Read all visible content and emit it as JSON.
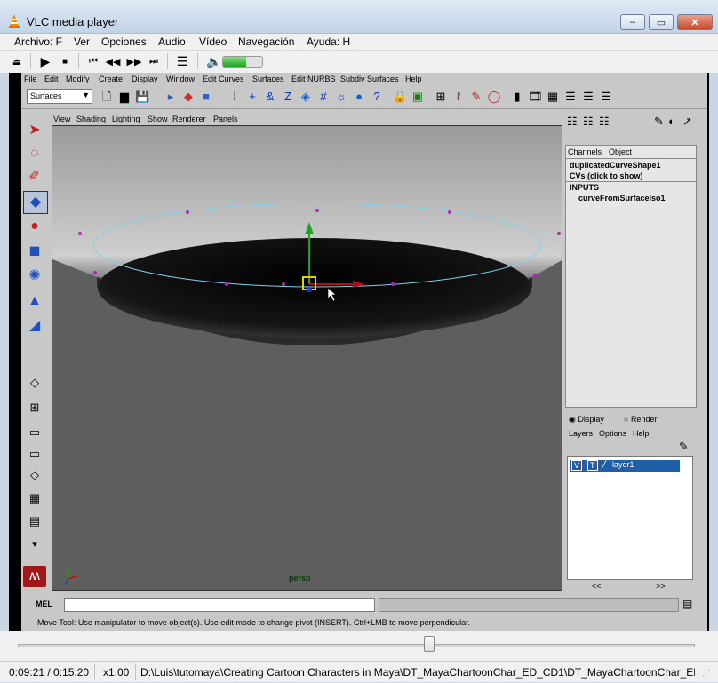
{
  "window": {
    "title": "VLC media player",
    "controls": {
      "minimize": "–",
      "maximize": "▭",
      "close": "✕"
    }
  },
  "menu": [
    "Archivo: F",
    "Ver",
    "Opciones",
    "Audio",
    "Vídeo",
    "Navegación",
    "Ayuda: H"
  ],
  "playback": {
    "icons": [
      "eject-icon",
      "play-icon",
      "stop-icon",
      "previous-icon",
      "rewind-icon",
      "fast-forward-icon",
      "next-icon",
      "playlist-icon",
      "volume-icon"
    ],
    "volume_level": 0.6,
    "seek_position": 0.607
  },
  "maya": {
    "menu": [
      "File",
      "Edit",
      "Modify",
      "Create",
      "Display",
      "Window",
      "Edit Curves",
      "Surfaces",
      "Edit NURBS",
      "Subdiv Surfaces",
      "Help"
    ],
    "shelf_mode": "Surfaces",
    "panel_menu": [
      "View",
      "Shading",
      "Lighting",
      "Show",
      "Renderer",
      "Panels"
    ],
    "viewport_label": "persp",
    "channel_tabs": [
      "Channels",
      "Object"
    ],
    "channel_node": "duplicatedCurveShape1",
    "channel_cvs": "CVs (click to show)",
    "inputs_header": "INPUTS",
    "input_node": "curveFromSurfaceIso1",
    "layer_mode": {
      "display": "Display",
      "render": "Render"
    },
    "layer_menu": [
      "Layers",
      "Options",
      "Help"
    ],
    "layer": {
      "v": "V",
      "t": "T",
      "name": "layer1"
    },
    "mel_label": "MEL",
    "help_line": "Move Tool: Use manipulator to move object(s). Use edit mode to change pivot (INSERT).  Ctrl+LMB to move perpendicular.",
    "scroll_left": "<<",
    "scroll_right": ">>"
  },
  "status": {
    "time": "0:09:21 / 0:15:20",
    "speed": "x1.00",
    "path": "D:\\Luis\\tutomaya\\Creating Cartoon Characters in Maya\\DT_MayaChartoonChar_ED_CD1\\DT_MayaChartoonChar_ED_("
  },
  "colors": {
    "accent_green": "#2fb82f",
    "vlc_orange": "#f28c00",
    "maya_bg": "#c8c8c8",
    "curve": "#7fd3e8"
  }
}
